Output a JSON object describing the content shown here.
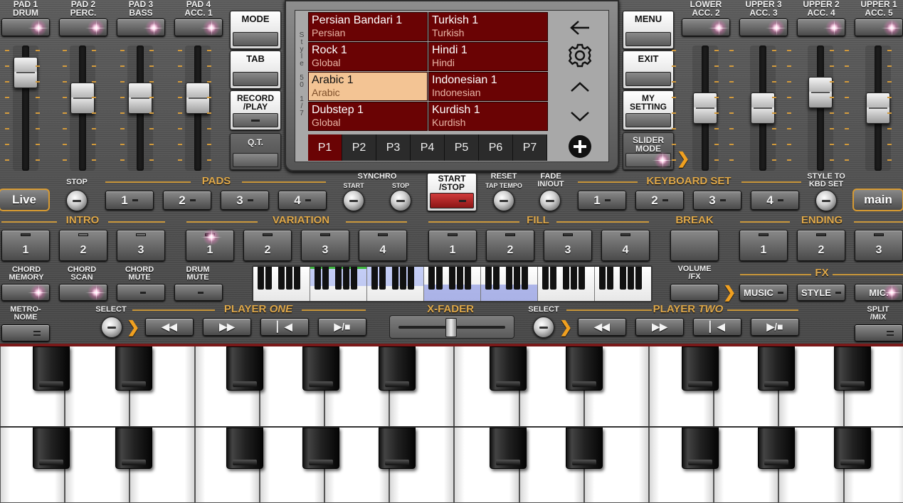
{
  "top_left_buttons": [
    {
      "label": "PAD 1\nDRUM"
    },
    {
      "label": "PAD 2\nPERC."
    },
    {
      "label": "PAD 3\nBASS"
    },
    {
      "label": "PAD 4\nACC. 1"
    }
  ],
  "top_right_buttons": [
    {
      "label": "LOWER\nACC. 2"
    },
    {
      "label": "UPPER 3\nACC. 3"
    },
    {
      "label": "UPPER 2\nACC. 4"
    },
    {
      "label": "UPPER 1\nACC. 5"
    }
  ],
  "left_menu": {
    "mode": "MODE",
    "tab": "TAB",
    "record": "RECORD\n/PLAY",
    "qt": "Q.T."
  },
  "right_menu": {
    "menu": "MENU",
    "exit": "EXIT",
    "my_setting": "MY\nSETTING",
    "slider_mode": "SLIDER\nMODE"
  },
  "screen": {
    "side_label": [
      "S",
      "t",
      "y",
      "l",
      "e",
      "",
      "5",
      "0",
      "",
      "1",
      "/",
      "7"
    ],
    "styles": [
      {
        "name": "Persian Bandari 1",
        "category": "Persian"
      },
      {
        "name": "Turkish 1",
        "category": "Turkish"
      },
      {
        "name": "Rock 1",
        "category": "Global"
      },
      {
        "name": "Hindi 1",
        "category": "Hindi"
      },
      {
        "name": "Arabic 1",
        "category": "Arabic"
      },
      {
        "name": "Indonesian 1",
        "category": "Indonesian"
      },
      {
        "name": "Dubstep 1",
        "category": "Global"
      },
      {
        "name": "Kurdish 1",
        "category": "Kurdish"
      }
    ],
    "selected_style": "Arabic 1",
    "pages": [
      "P1",
      "P2",
      "P3",
      "P4",
      "P5",
      "P6",
      "P7"
    ],
    "active_page": "P1",
    "icons": [
      "back-arrow-icon",
      "gear-icon",
      "chevron-up-icon",
      "chevron-down-icon",
      "plus-circle-icon"
    ]
  },
  "row2": {
    "live": "Live",
    "stop": "STOP",
    "pads": "PADS",
    "pad_buttons": [
      "1",
      "2",
      "3",
      "4"
    ],
    "synchro": "SYNCHRO",
    "synchro_start": "START",
    "synchro_stop": "STOP",
    "start_stop": "START\n/STOP",
    "reset": "RESET",
    "tap_tempo": "TAP TEMPO",
    "fade": "FADE\nIN/OUT",
    "keyboard_set": "KEYBOARD SET",
    "kbd_buttons": [
      "1",
      "2",
      "3",
      "4"
    ],
    "style_to_kbd": "STYLE TO\nKBD SET",
    "main": "main"
  },
  "row3": {
    "intro": "INTRO",
    "intro_buttons": [
      "1",
      "2",
      "3"
    ],
    "variation": "VARIATION",
    "variation_buttons": [
      "1",
      "2",
      "3",
      "4"
    ],
    "fill": "FILL",
    "fill_buttons": [
      "1",
      "2",
      "3",
      "4"
    ],
    "break": "BREAK",
    "ending": "ENDING",
    "ending_buttons": [
      "1",
      "2",
      "3"
    ]
  },
  "row4": {
    "chord_memory": "CHORD\nMEMORY",
    "chord_scan": "CHORD\nSCAN",
    "chord_mute": "CHORD\nMUTE",
    "drum_mute": "DRUM\nMUTE",
    "volume_fx": "VOLUME\n/FX",
    "fx": "FX",
    "music": "MUSIC",
    "style": "STYLE",
    "mic": "MIC."
  },
  "row5": {
    "metronome": "METRO-\nNOME",
    "select_1": "SELECT",
    "player_one_prefix": "PLAYER",
    "player_one_num": "ONE",
    "xfader": "X-FADER",
    "select_2": "SELECT",
    "player_two_prefix": "PLAYER",
    "player_two_num": "TWO",
    "split_mix": "SPLIT\n/MIX"
  },
  "colors": {
    "accent": "#e0a94a",
    "lcd_cell": "#6a0304",
    "lcd_selected": "#f3c494",
    "mini_keyboard_highlight": "#a9b4f0"
  }
}
